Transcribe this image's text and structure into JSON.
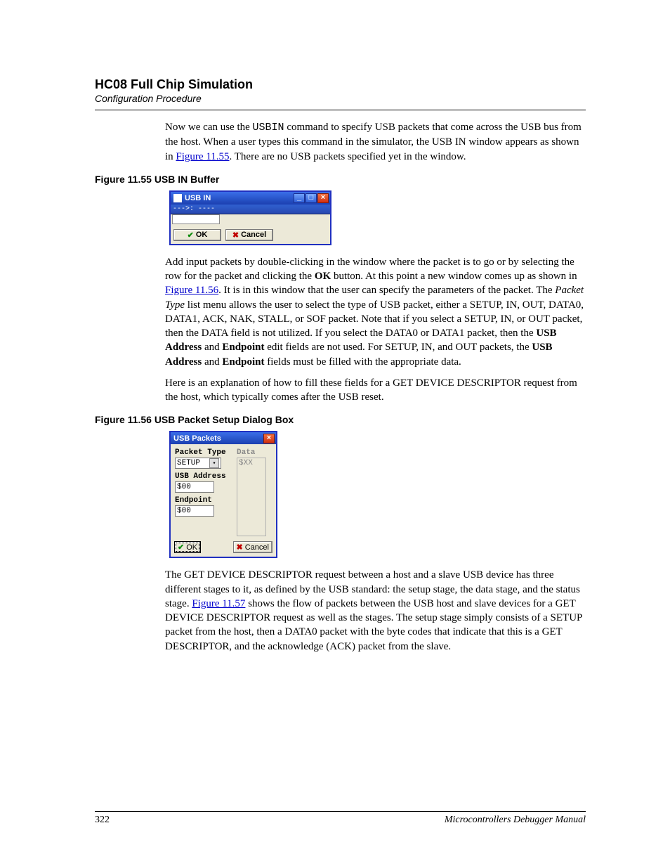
{
  "header": {
    "title": "HC08 Full Chip Simulation",
    "subtitle": "Configuration Procedure"
  },
  "para1": {
    "t1": "Now we can use the ",
    "cmd": "USBIN",
    "t2": " command to specify USB packets that come across the USB bus from the host. When a user types this command in the simulator, the USB IN window appears as shown in ",
    "link": "Figure 11.55",
    "t3": ". There are no USB packets specified yet in the window."
  },
  "fig55": {
    "caption": "Figure 11.55  USB IN Buffer",
    "window": {
      "title": "USB IN",
      "cmdline": "--->: ----",
      "ok": "OK",
      "cancel": "Cancel"
    }
  },
  "para2": {
    "t1": "Add input packets by double-clicking in the window where the packet is to go or by selecting the row for the packet and clicking the ",
    "b1": "OK",
    "t2": " button. At this point a new window comes up as shown in ",
    "link": "Figure 11.56",
    "t3": ". It is in this window that the user can specify the parameters of the packet. The ",
    "i1": "Packet Type",
    "t4": " list menu allows the user to select the type of USB packet, either a SETUP, IN, OUT, DATA0, DATA1, ACK, NAK, STALL, or SOF packet. Note that if you select a SETUP, IN, or OUT packet, then the DATA field is not utilized. If you select the DATA0 or DATA1 packet, then the ",
    "b2": "USB Address",
    "t5": " and ",
    "b3": "Endpoint",
    "t6": " edit fields are not used. For SETUP, IN, and OUT packets, the ",
    "b4": "USB Address",
    "t7": " and ",
    "b5": "Endpoint",
    "t8": " fields must be filled with the appropriate data."
  },
  "para3": "Here is an explanation of how to fill these fields for a GET DEVICE DESCRIPTOR request from the host, which typically comes after the USB reset.",
  "fig56": {
    "caption": "Figure 11.56  USB Packet Setup Dialog Box",
    "window": {
      "title": "USB Packets",
      "packet_type_label": "Packet Type",
      "packet_type_value": "SETUP",
      "data_label": "Data",
      "data_value": "$XX",
      "usb_addr_label": "USB Address",
      "usb_addr_value": "$00",
      "endpoint_label": "Endpoint",
      "endpoint_value": "$00",
      "ok": "OK",
      "cancel": "Cancel"
    }
  },
  "para4": {
    "t1": "The GET DEVICE DESCRIPTOR request between a host and a slave USB device has three different stages to it, as defined by the USB standard: the setup stage, the data stage, and the status stage. ",
    "link": "Figure 11.57",
    "t2": " shows the flow of packets between the USB host and slave devices for a GET DEVICE DESCRIPTOR request as well as the stages. The setup stage simply consists of a SETUP packet from the host, then a DATA0 packet with the byte codes that indicate that this is a GET DESCRIPTOR, and the acknowledge (ACK) packet from the slave."
  },
  "footer": {
    "page": "322",
    "manual": "Microcontrollers Debugger Manual"
  }
}
